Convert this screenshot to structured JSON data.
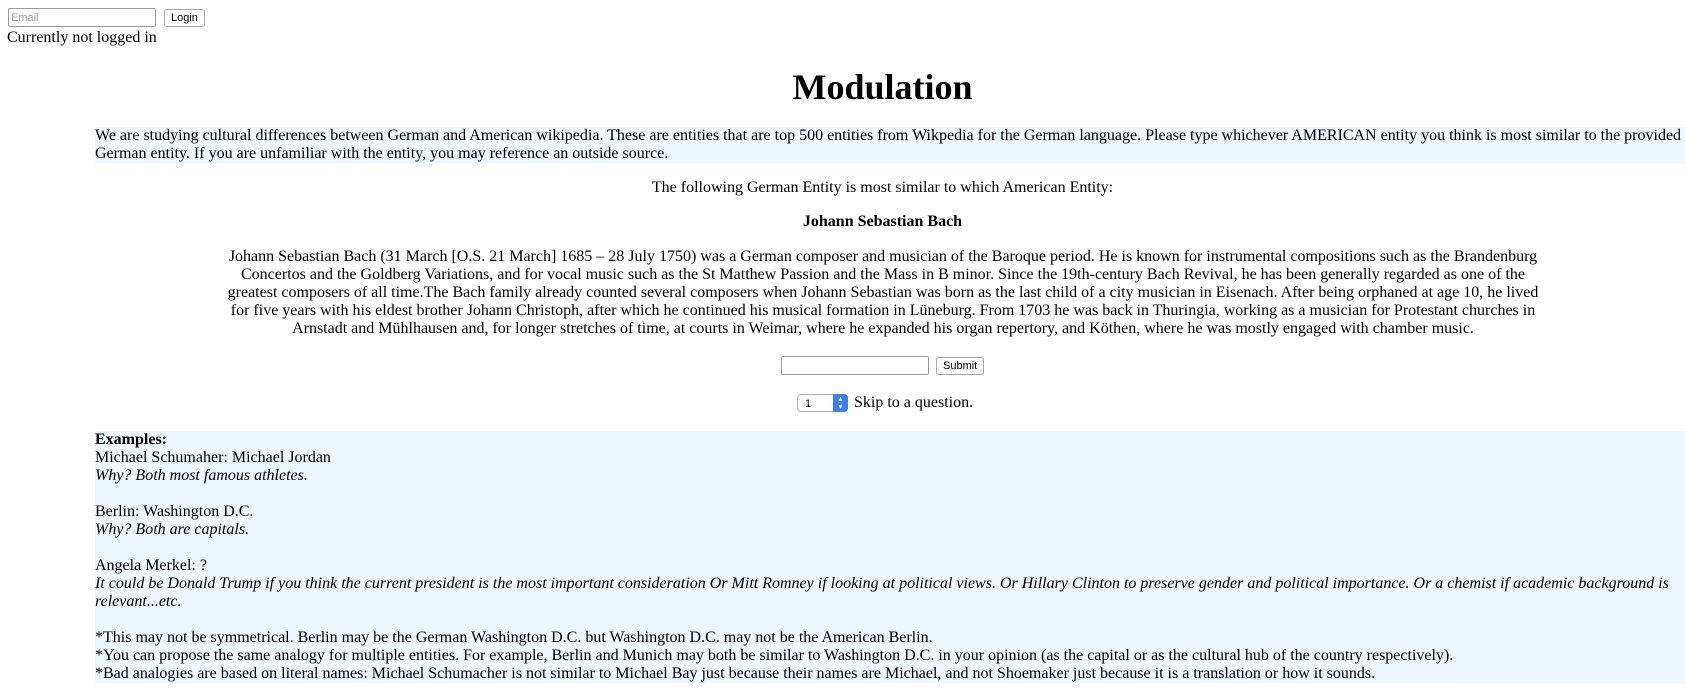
{
  "login": {
    "email_placeholder": "Email",
    "login_label": "Login",
    "status": "Currently not logged in"
  },
  "page": {
    "title": "Modulation",
    "intro": "We are studying cultural differences between German and American wikipedia. These are entities that are top 500 entities from Wikpedia for the German language. Please type whichever AMERICAN entity you think is most similar to the provided German entity. If you are unfamiliar with the entity, you may reference an outside source.",
    "prompt": "The following German Entity is most similar to which American Entity:"
  },
  "entity": {
    "name": "Johann Sebastian Bach",
    "description": "Johann Sebastian Bach (31 March [O.S. 21 March] 1685 – 28 July 1750) was a German composer and musician of the Baroque period. He is known for instrumental compositions such as the Brandenburg Concertos and the Goldberg Variations, and for vocal music such as the St Matthew Passion and the Mass in B minor. Since the 19th-century Bach Revival, he has been generally regarded as one of the greatest composers of all time.The Bach family already counted several composers when Johann Sebastian was born as the last child of a city musician in Eisenach. After being orphaned at age 10, he lived for five years with his eldest brother Johann Christoph, after which he continued his musical formation in Lüneburg. From 1703 he was back in Thuringia, working as a musician for Protestant churches in Arnstadt and Mühlhausen and, for longer stretches of time, at courts in Weimar, where he expanded his organ repertory, and Köthen, where he was mostly engaged with chamber music."
  },
  "answer": {
    "value": "",
    "submit_label": "Submit"
  },
  "skip": {
    "selected": "1",
    "label": "Skip to a question."
  },
  "examples": {
    "heading": "Examples:",
    "items": [
      {
        "pair": "Michael Schumaher: Michael Jordan",
        "why": "Why? Both most famous athletes."
      },
      {
        "pair": "Berlin: Washington D.C.",
        "why": "Why? Both are capitals."
      },
      {
        "pair": "Angela Merkel: ?",
        "why": "It could be Donald Trump if you think the current president is the most important consideration Or Mitt Romney if looking at political views. Or Hillary Clinton to preserve gender and political importance. Or a chemist if academic background is relevant...etc."
      }
    ],
    "notes": [
      "*This may not be symmetrical. Berlin may be the German Washington D.C. but Washington D.C. may not be the American Berlin.",
      "*You can propose the same analogy for multiple entities. For example, Berlin and Munich may both be similar to Washington D.C. in your opinion (as the capital or as the cultural hub of the country respectively).",
      "*Bad analogies are based on literal names: Michael Schumacher is not similar to Michael Bay just because their names are Michael, and not Shoemaker just because it is a translation or how it sounds."
    ]
  },
  "colors": {
    "highlight_background": "#eef6ff",
    "select_accent": "#3d7ff0"
  }
}
